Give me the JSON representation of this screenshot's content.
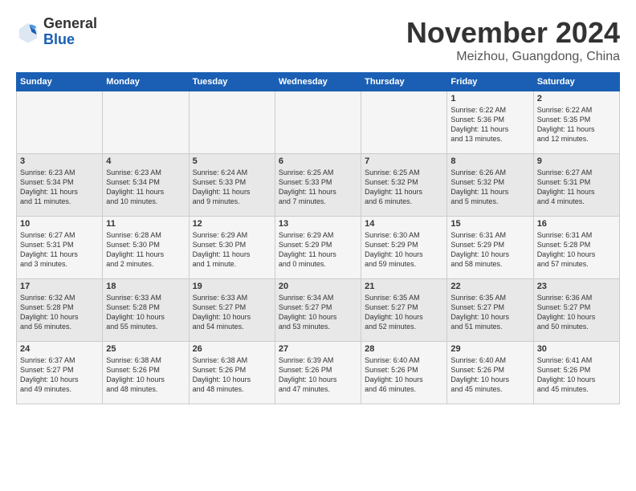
{
  "header": {
    "logo_general": "General",
    "logo_blue": "Blue",
    "title": "November 2024",
    "location": "Meizhou, Guangdong, China"
  },
  "weekdays": [
    "Sunday",
    "Monday",
    "Tuesday",
    "Wednesday",
    "Thursday",
    "Friday",
    "Saturday"
  ],
  "weeks": [
    [
      {
        "day": "",
        "info": ""
      },
      {
        "day": "",
        "info": ""
      },
      {
        "day": "",
        "info": ""
      },
      {
        "day": "",
        "info": ""
      },
      {
        "day": "",
        "info": ""
      },
      {
        "day": "1",
        "info": "Sunrise: 6:22 AM\nSunset: 5:36 PM\nDaylight: 11 hours\nand 13 minutes."
      },
      {
        "day": "2",
        "info": "Sunrise: 6:22 AM\nSunset: 5:35 PM\nDaylight: 11 hours\nand 12 minutes."
      }
    ],
    [
      {
        "day": "3",
        "info": "Sunrise: 6:23 AM\nSunset: 5:34 PM\nDaylight: 11 hours\nand 11 minutes."
      },
      {
        "day": "4",
        "info": "Sunrise: 6:23 AM\nSunset: 5:34 PM\nDaylight: 11 hours\nand 10 minutes."
      },
      {
        "day": "5",
        "info": "Sunrise: 6:24 AM\nSunset: 5:33 PM\nDaylight: 11 hours\nand 9 minutes."
      },
      {
        "day": "6",
        "info": "Sunrise: 6:25 AM\nSunset: 5:33 PM\nDaylight: 11 hours\nand 7 minutes."
      },
      {
        "day": "7",
        "info": "Sunrise: 6:25 AM\nSunset: 5:32 PM\nDaylight: 11 hours\nand 6 minutes."
      },
      {
        "day": "8",
        "info": "Sunrise: 6:26 AM\nSunset: 5:32 PM\nDaylight: 11 hours\nand 5 minutes."
      },
      {
        "day": "9",
        "info": "Sunrise: 6:27 AM\nSunset: 5:31 PM\nDaylight: 11 hours\nand 4 minutes."
      }
    ],
    [
      {
        "day": "10",
        "info": "Sunrise: 6:27 AM\nSunset: 5:31 PM\nDaylight: 11 hours\nand 3 minutes."
      },
      {
        "day": "11",
        "info": "Sunrise: 6:28 AM\nSunset: 5:30 PM\nDaylight: 11 hours\nand 2 minutes."
      },
      {
        "day": "12",
        "info": "Sunrise: 6:29 AM\nSunset: 5:30 PM\nDaylight: 11 hours\nand 1 minute."
      },
      {
        "day": "13",
        "info": "Sunrise: 6:29 AM\nSunset: 5:29 PM\nDaylight: 11 hours\nand 0 minutes."
      },
      {
        "day": "14",
        "info": "Sunrise: 6:30 AM\nSunset: 5:29 PM\nDaylight: 10 hours\nand 59 minutes."
      },
      {
        "day": "15",
        "info": "Sunrise: 6:31 AM\nSunset: 5:29 PM\nDaylight: 10 hours\nand 58 minutes."
      },
      {
        "day": "16",
        "info": "Sunrise: 6:31 AM\nSunset: 5:28 PM\nDaylight: 10 hours\nand 57 minutes."
      }
    ],
    [
      {
        "day": "17",
        "info": "Sunrise: 6:32 AM\nSunset: 5:28 PM\nDaylight: 10 hours\nand 56 minutes."
      },
      {
        "day": "18",
        "info": "Sunrise: 6:33 AM\nSunset: 5:28 PM\nDaylight: 10 hours\nand 55 minutes."
      },
      {
        "day": "19",
        "info": "Sunrise: 6:33 AM\nSunset: 5:27 PM\nDaylight: 10 hours\nand 54 minutes."
      },
      {
        "day": "20",
        "info": "Sunrise: 6:34 AM\nSunset: 5:27 PM\nDaylight: 10 hours\nand 53 minutes."
      },
      {
        "day": "21",
        "info": "Sunrise: 6:35 AM\nSunset: 5:27 PM\nDaylight: 10 hours\nand 52 minutes."
      },
      {
        "day": "22",
        "info": "Sunrise: 6:35 AM\nSunset: 5:27 PM\nDaylight: 10 hours\nand 51 minutes."
      },
      {
        "day": "23",
        "info": "Sunrise: 6:36 AM\nSunset: 5:27 PM\nDaylight: 10 hours\nand 50 minutes."
      }
    ],
    [
      {
        "day": "24",
        "info": "Sunrise: 6:37 AM\nSunset: 5:27 PM\nDaylight: 10 hours\nand 49 minutes."
      },
      {
        "day": "25",
        "info": "Sunrise: 6:38 AM\nSunset: 5:26 PM\nDaylight: 10 hours\nand 48 minutes."
      },
      {
        "day": "26",
        "info": "Sunrise: 6:38 AM\nSunset: 5:26 PM\nDaylight: 10 hours\nand 48 minutes."
      },
      {
        "day": "27",
        "info": "Sunrise: 6:39 AM\nSunset: 5:26 PM\nDaylight: 10 hours\nand 47 minutes."
      },
      {
        "day": "28",
        "info": "Sunrise: 6:40 AM\nSunset: 5:26 PM\nDaylight: 10 hours\nand 46 minutes."
      },
      {
        "day": "29",
        "info": "Sunrise: 6:40 AM\nSunset: 5:26 PM\nDaylight: 10 hours\nand 45 minutes."
      },
      {
        "day": "30",
        "info": "Sunrise: 6:41 AM\nSunset: 5:26 PM\nDaylight: 10 hours\nand 45 minutes."
      }
    ]
  ]
}
